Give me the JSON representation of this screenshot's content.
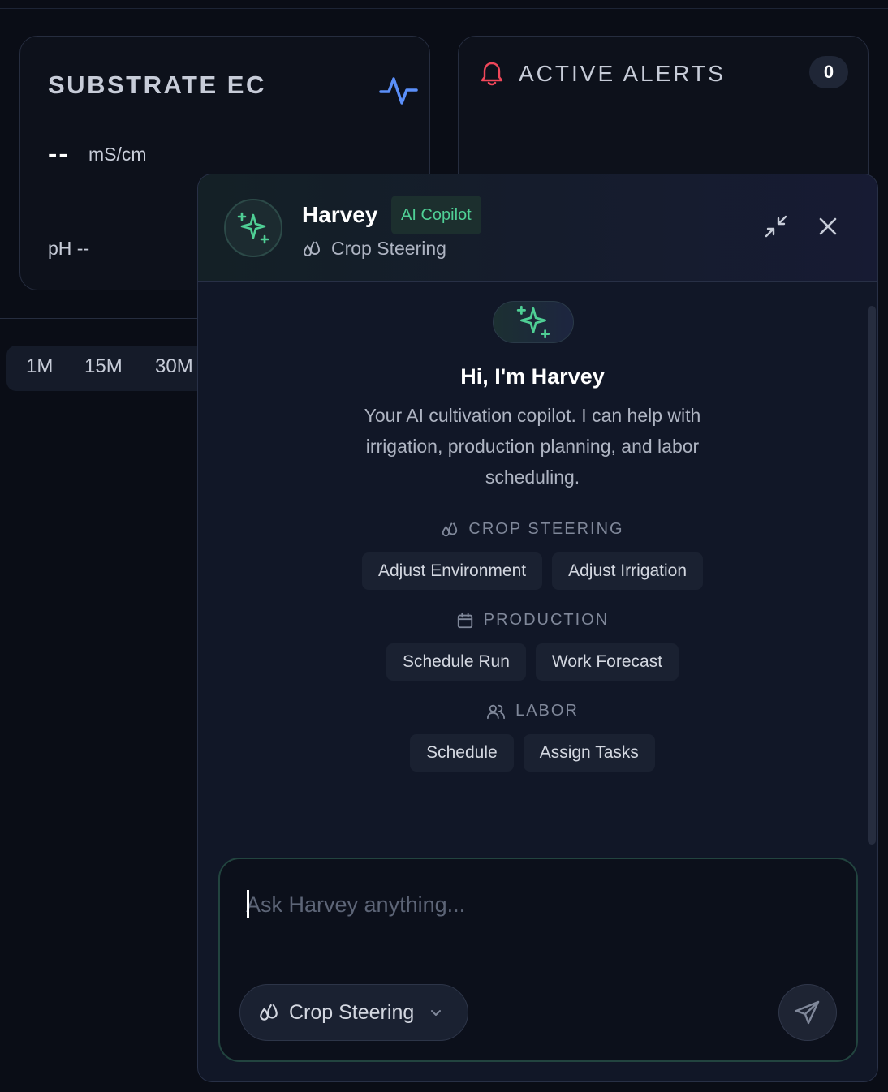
{
  "ec_card": {
    "title": "SUBSTRATE EC",
    "value": "--",
    "unit": "mS/cm",
    "ph_label": "pH --"
  },
  "alerts_card": {
    "title": "ACTIVE ALERTS",
    "count": "0"
  },
  "time_range": {
    "options": [
      "1M",
      "15M",
      "30M"
    ]
  },
  "chat": {
    "bot_name": "Harvey",
    "badge": "AI Copilot",
    "context": "Crop Steering",
    "greeting": "Hi, I'm Harvey",
    "intro": "Your AI cultivation copilot. I can help with irrigation, production planning, and labor scheduling.",
    "sections": [
      {
        "label": "CROP STEERING",
        "icon": "droplets-icon",
        "chips": [
          "Adjust Environment",
          "Adjust Irrigation"
        ]
      },
      {
        "label": "PRODUCTION",
        "icon": "calendar-icon",
        "chips": [
          "Schedule Run",
          "Work Forecast"
        ]
      },
      {
        "label": "LABOR",
        "icon": "users-icon",
        "chips": [
          "Schedule",
          "Assign Tasks"
        ]
      }
    ],
    "input_placeholder": "Ask Harvey anything...",
    "mode_label": "Crop Steering"
  },
  "colors": {
    "accent_green": "#4fcf95",
    "alert_red": "#f0475a",
    "pulse_blue": "#5b8ff9"
  }
}
